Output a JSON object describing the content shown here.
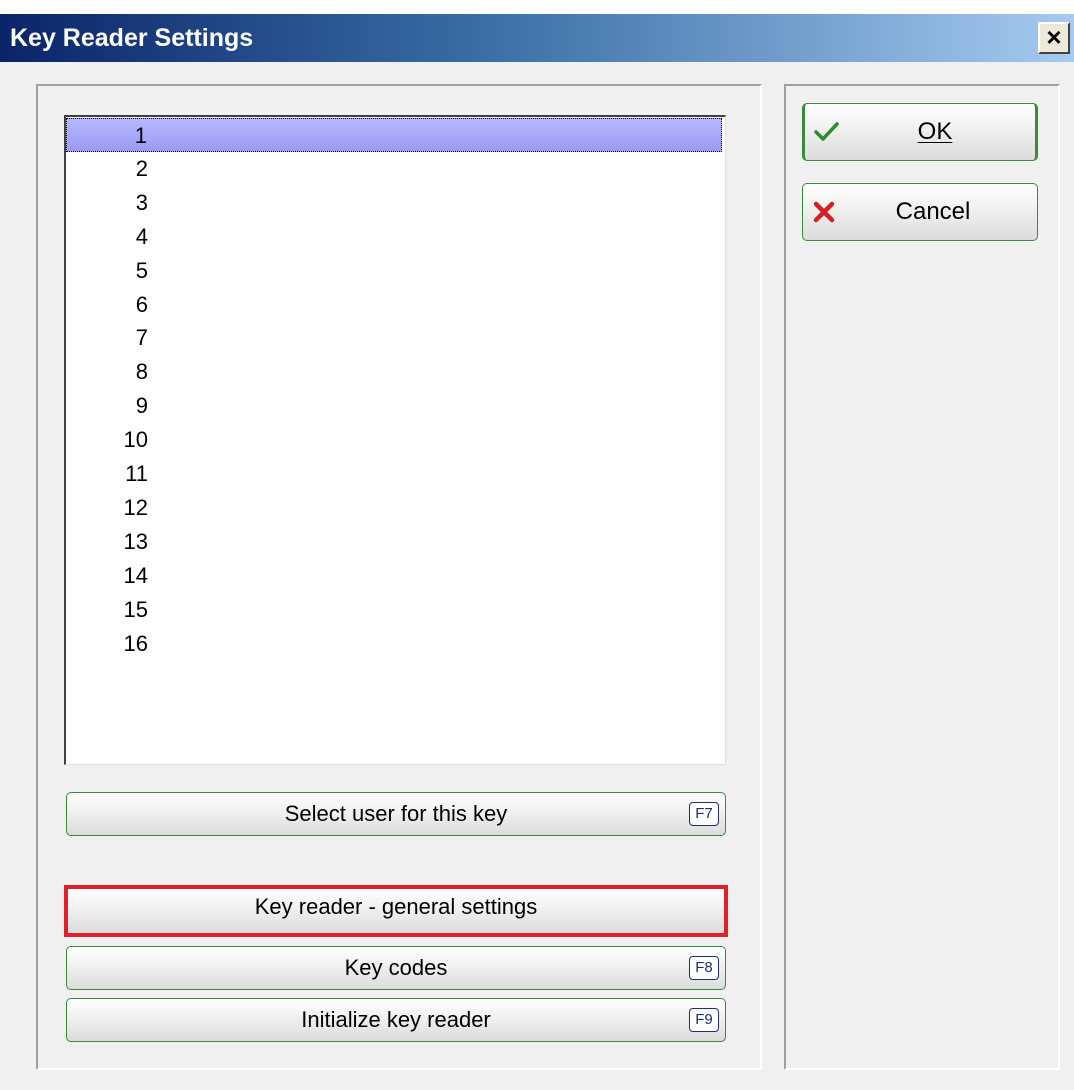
{
  "window": {
    "title": "Key Reader Settings",
    "close_label": "×"
  },
  "list": {
    "items": [
      "1",
      "2",
      "3",
      "4",
      "5",
      "6",
      "7",
      "8",
      "9",
      "10",
      "11",
      "12",
      "13",
      "14",
      "15",
      "16"
    ],
    "selected_index": 0
  },
  "buttons": {
    "ok_label": "OK",
    "cancel_label": "Cancel",
    "select_user_label": "Select user for this key",
    "select_user_key": "F7",
    "general_settings_label": "Key reader - general settings",
    "key_codes_label": "Key codes",
    "key_codes_key": "F8",
    "initialize_label": "Initialize key reader",
    "initialize_key": "F9"
  },
  "icons": {
    "ok": "checkmark-icon",
    "cancel": "x-icon"
  },
  "colors": {
    "selection": "#a8a8fa",
    "button_border": "#3c8a3c",
    "highlight": "#e0202a",
    "check": "#2e8b2e",
    "cross": "#d42020"
  }
}
